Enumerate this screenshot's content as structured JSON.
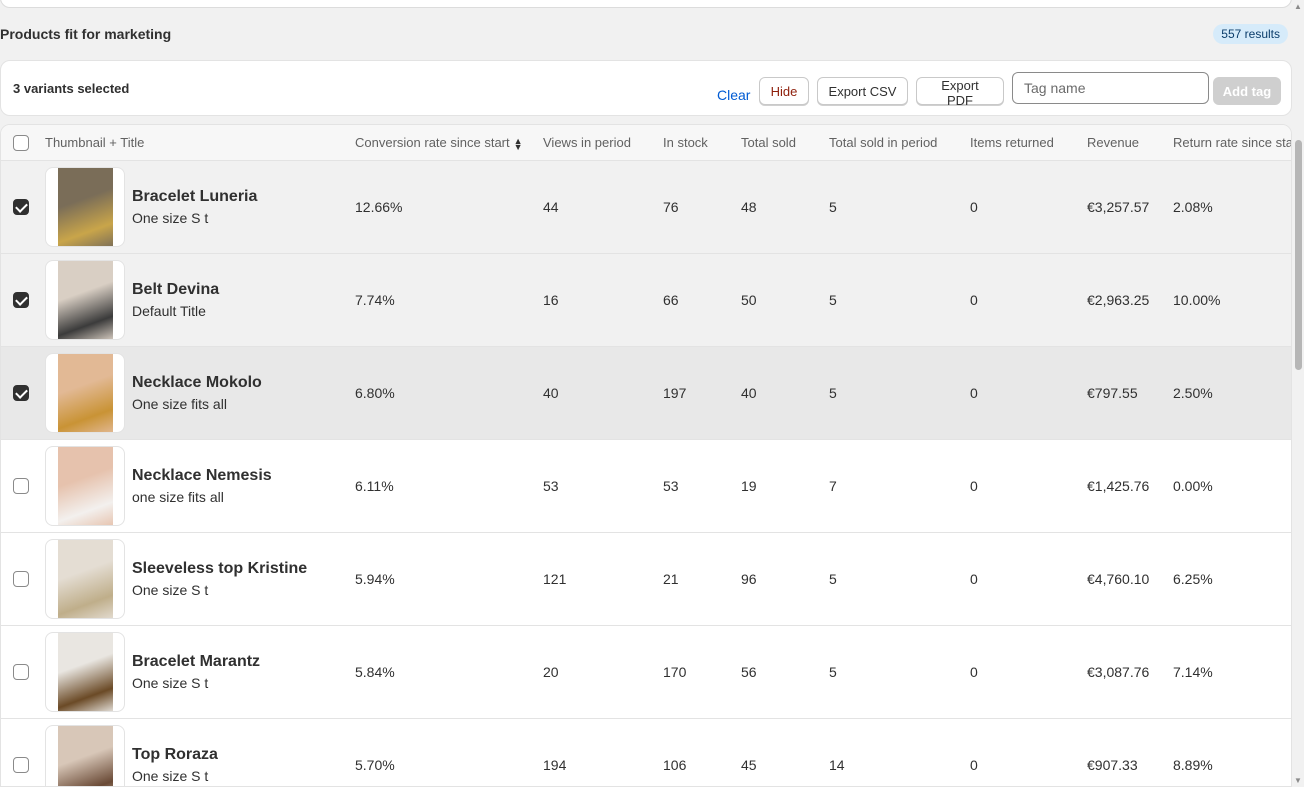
{
  "section": {
    "title": "Products fit for marketing",
    "results_badge": "557 results"
  },
  "bulk_bar": {
    "selected_text": "3 variants selected",
    "clear_label": "Clear",
    "hide_label": "Hide",
    "export_csv_label": "Export CSV",
    "export_pdf_label": "Export PDF",
    "tag_placeholder": "Tag name",
    "add_tag_label": "Add tag"
  },
  "table": {
    "headers": {
      "title": "Thumbnail + Title",
      "conversion": "Conversion rate since start",
      "views": "Views in period",
      "in_stock": "In stock",
      "total_sold": "Total sold",
      "sold_period": "Total sold in period",
      "returned": "Items returned",
      "revenue": "Revenue",
      "return_rate": "Return rate since start"
    },
    "rows": [
      {
        "title": "Bracelet Luneria",
        "variant": "One size S t",
        "conversion": "12.66%",
        "views": "44",
        "in_stock": "76",
        "total_sold": "48",
        "sold_period": "5",
        "returned": "0",
        "revenue": "€3,257.57",
        "return_rate": "2.08%",
        "checked": true,
        "thumb_colors": [
          "#7a6d58",
          "#c9a54a"
        ]
      },
      {
        "title": "Belt Devina",
        "variant": "Default Title",
        "conversion": "7.74%",
        "views": "16",
        "in_stock": "66",
        "total_sold": "50",
        "sold_period": "5",
        "returned": "0",
        "revenue": "€2,963.25",
        "return_rate": "10.00%",
        "checked": true,
        "thumb_colors": [
          "#d9cfc4",
          "#3b3b3b"
        ]
      },
      {
        "title": "Necklace Mokolo",
        "variant": "One size fits all",
        "conversion": "6.80%",
        "views": "40",
        "in_stock": "197",
        "total_sold": "40",
        "sold_period": "5",
        "returned": "0",
        "revenue": "€797.55",
        "return_rate": "2.50%",
        "checked": true,
        "thumb_colors": [
          "#e2b995",
          "#c99335"
        ]
      },
      {
        "title": "Necklace Nemesis",
        "variant": "one size fits all",
        "conversion": "6.11%",
        "views": "53",
        "in_stock": "53",
        "total_sold": "19",
        "sold_period": "7",
        "returned": "0",
        "revenue": "€1,425.76",
        "return_rate": "0.00%",
        "checked": false,
        "thumb_colors": [
          "#e6c2ad",
          "#f3f0ee"
        ]
      },
      {
        "title": "Sleeveless top Kristine",
        "variant": "One size S t",
        "conversion": "5.94%",
        "views": "121",
        "in_stock": "21",
        "total_sold": "96",
        "sold_period": "5",
        "returned": "0",
        "revenue": "€4,760.10",
        "return_rate": "6.25%",
        "checked": false,
        "thumb_colors": [
          "#e4ddd3",
          "#bfae8a"
        ]
      },
      {
        "title": "Bracelet Marantz",
        "variant": "One size S t",
        "conversion": "5.84%",
        "views": "20",
        "in_stock": "170",
        "total_sold": "56",
        "sold_period": "5",
        "returned": "0",
        "revenue": "€3,087.76",
        "return_rate": "7.14%",
        "checked": false,
        "thumb_colors": [
          "#e9e6e1",
          "#6b4a26"
        ]
      },
      {
        "title": "Top Roraza",
        "variant": "One size S t",
        "conversion": "5.70%",
        "views": "194",
        "in_stock": "106",
        "total_sold": "45",
        "sold_period": "14",
        "returned": "0",
        "revenue": "€907.33",
        "return_rate": "8.89%",
        "checked": false,
        "thumb_colors": [
          "#d8c7b8",
          "#6a4a36"
        ]
      }
    ]
  }
}
